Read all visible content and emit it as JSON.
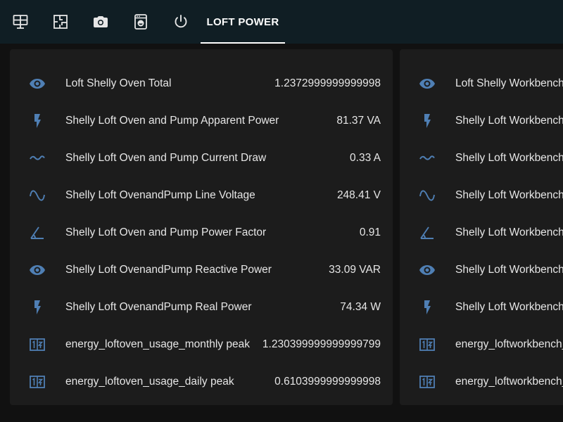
{
  "topbar": {
    "tabs": [
      {
        "icon": "dashboard-icon"
      },
      {
        "icon": "floorplan-icon"
      },
      {
        "icon": "camera-icon"
      },
      {
        "icon": "washing-machine-icon"
      },
      {
        "icon": "power-icon"
      }
    ],
    "active_tab_label": "LOFT POWER"
  },
  "cards": [
    {
      "rows": [
        {
          "icon": "eye-icon",
          "name": "Loft Shelly Oven Total",
          "value": "1.2372999999999998"
        },
        {
          "icon": "flash-icon",
          "name": "Shelly Loft Oven and Pump Apparent Power",
          "value": "81.37 VA"
        },
        {
          "icon": "current-ac-icon",
          "name": "Shelly Loft Oven and Pump Current Draw",
          "value": "0.33 A"
        },
        {
          "icon": "sine-wave-icon",
          "name": "Shelly Loft OvenandPump Line Voltage",
          "value": "248.41 V"
        },
        {
          "icon": "angle-icon",
          "name": "Shelly Loft Oven and Pump Power Factor",
          "value": "0.91"
        },
        {
          "icon": "eye-icon",
          "name": "Shelly Loft OvenandPump Reactive Power",
          "value": "33.09 VAR"
        },
        {
          "icon": "flash-icon",
          "name": "Shelly Loft OvenandPump Real Power",
          "value": "74.34 W"
        },
        {
          "icon": "counter-icon",
          "name": "energy_loftoven_usage_monthly peak",
          "value": "1.230399999999999799"
        },
        {
          "icon": "counter-icon",
          "name": "energy_loftoven_usage_daily peak",
          "value": "0.6103999999999998"
        }
      ]
    },
    {
      "rows": [
        {
          "icon": "eye-icon",
          "name": "Loft Shelly Workbench"
        },
        {
          "icon": "flash-icon",
          "name": "Shelly Loft Workbench"
        },
        {
          "icon": "current-ac-icon",
          "name": "Shelly Loft Workbench"
        },
        {
          "icon": "sine-wave-icon",
          "name": "Shelly Loft Workbench"
        },
        {
          "icon": "angle-icon",
          "name": "Shelly Loft Workbench"
        },
        {
          "icon": "eye-icon",
          "name": "Shelly Loft Workbench"
        },
        {
          "icon": "flash-icon",
          "name": "Shelly Loft Workbench"
        },
        {
          "icon": "counter-icon",
          "name": "energy_loftworkbench_"
        },
        {
          "icon": "counter-icon",
          "name": "energy_loftworkbench_"
        }
      ]
    }
  ],
  "colors": {
    "icon": "#4f7fb4",
    "topbar_icon": "#e6e6e6",
    "topbar_bg": "#101e24",
    "card_bg": "#1c1c1c"
  }
}
